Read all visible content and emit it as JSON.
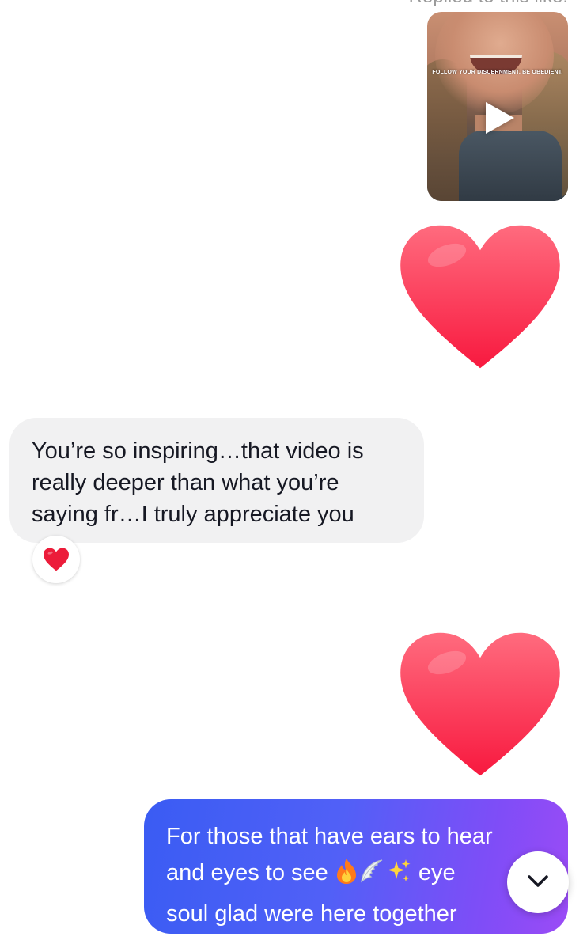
{
  "header": {
    "replied_label": "Replied to this like:"
  },
  "video": {
    "caption": "FOLLOW YOUR DISCERNMENT. BE OBEDIENT."
  },
  "messages": [
    {
      "type": "emoji",
      "emoji": "heart",
      "from": "me"
    },
    {
      "type": "text",
      "from": "them",
      "text_lines": [
        "You’re so inspiring…that video is",
        "really deeper than what you’re",
        "saying fr…I truly appreciate you"
      ],
      "reaction": "heart"
    },
    {
      "type": "emoji",
      "emoji": "heart",
      "from": "me"
    },
    {
      "type": "text",
      "from": "me",
      "line1": "For those that have ears to hear",
      "line2_start": "and eyes to see ",
      "line2_end": " eye",
      "line3": "soul glad were here together",
      "inline_icons": [
        "fire-icon",
        "wing-icon",
        "sparkles-icon"
      ]
    }
  ],
  "colors": {
    "incoming_bubble": "#f1f1f2",
    "outgoing_bubble_start": "#3a5cf3",
    "outgoing_bubble_end": "#9b4bf6",
    "heart": "#fe2c55"
  },
  "icons": {
    "play": "play-icon",
    "scroll": "chevron-down-icon"
  }
}
